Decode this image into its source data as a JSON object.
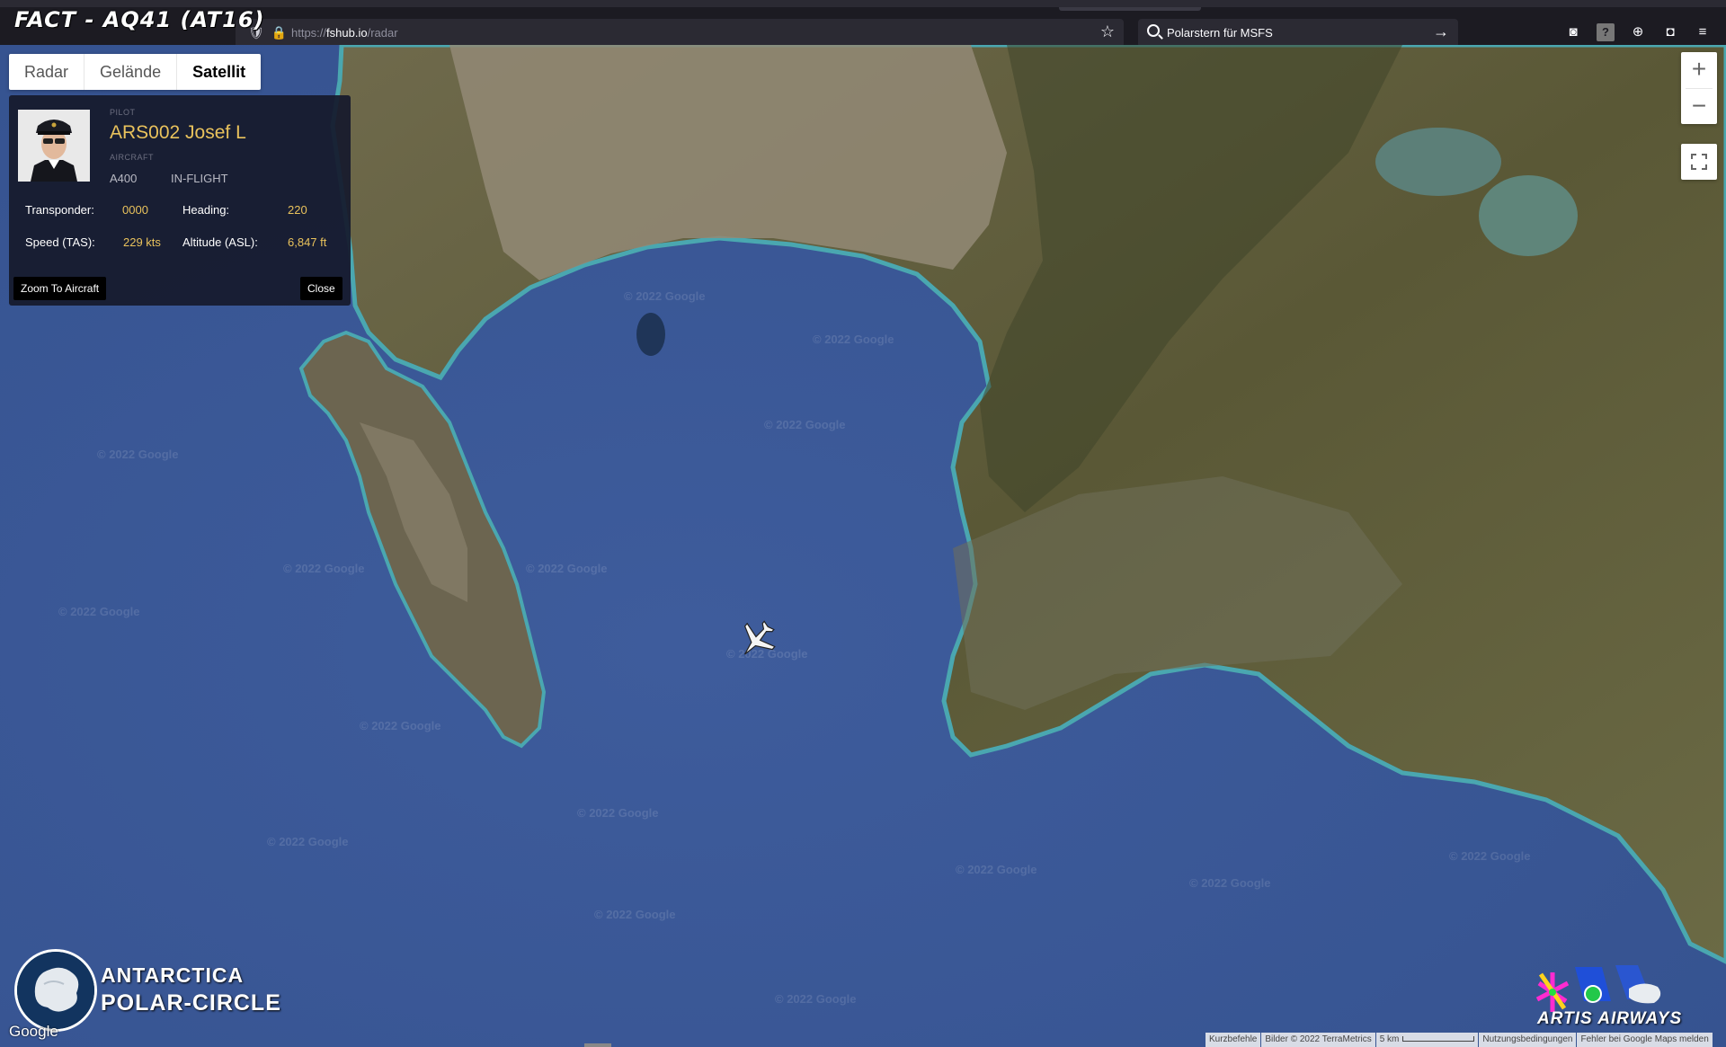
{
  "stream_title": "FACT - AQ41 (AT16)",
  "browser": {
    "url_scheme": "https://",
    "url_host": "fshub.io",
    "url_path": "/radar",
    "search_text": "Polarstern für MSFS"
  },
  "map_types": [
    {
      "label": "Radar",
      "active": false
    },
    {
      "label": "Gelände",
      "active": false
    },
    {
      "label": "Satellit",
      "active": true
    }
  ],
  "zoom": {
    "in_label": "+",
    "out_label": "−"
  },
  "pilot_panel": {
    "pilot_label": "PILOT",
    "pilot_name": "ARS002 Josef L",
    "aircraft_label": "AIRCRAFT",
    "aircraft_type": "A400",
    "status": "IN-FLIGHT",
    "transponder_label": "Transponder:",
    "transponder_value": "0000",
    "heading_label": "Heading:",
    "heading_value": "220",
    "speed_label": "Speed (TAS):",
    "speed_value": "229 kts",
    "altitude_label": "Altitude (ASL):",
    "altitude_value": "6,847 ft",
    "zoom_button": "Zoom To Aircraft",
    "close_button": "Close"
  },
  "watermark_text": "© 2022 Google",
  "overlays": {
    "antarctica_line1": "ANTARCTICA",
    "antarctica_line2": "POLAR-CIRCLE",
    "google_logo": "Google",
    "artis_text": "ARTIS AIRWAYS"
  },
  "attribution": {
    "shortcuts": "Kurzbefehle",
    "imagery": "Bilder © 2022 TerraMetrics",
    "scale": "5 km",
    "terms": "Nutzungsbedingungen",
    "report": "Fehler bei Google Maps melden"
  },
  "colors": {
    "ocean": "#3b5898",
    "land": "#5e5a3a",
    "accent_gold": "#e9c25c",
    "panel_bg": "#161a2c"
  }
}
